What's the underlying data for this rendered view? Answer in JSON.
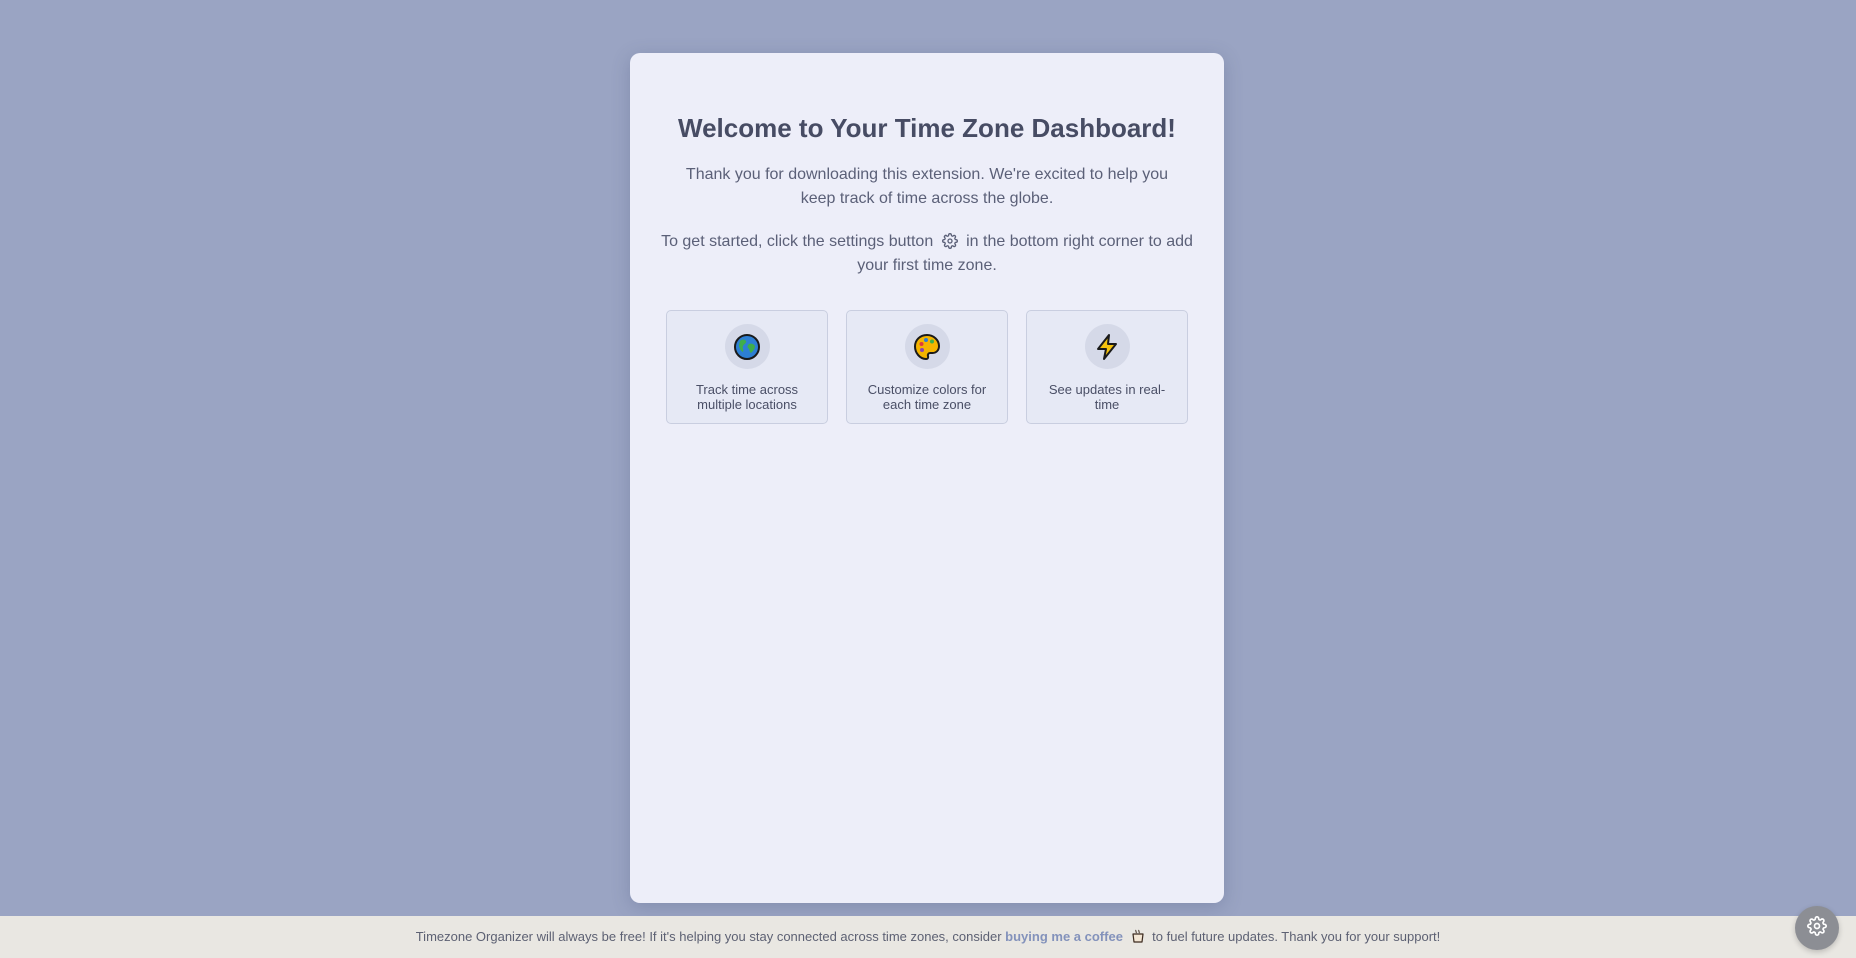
{
  "welcome": {
    "title": "Welcome to Your Time Zone Dashboard!",
    "intro": "Thank you for downloading this extension. We're excited to help you keep track of time across the globe.",
    "instructions_before": "To get started, click the settings button",
    "instructions_after": "in the bottom right corner to add your first time zone."
  },
  "features": [
    {
      "icon": "globe-icon",
      "text": "Track time across multiple locations"
    },
    {
      "icon": "palette-icon",
      "text": "Customize colors for each time zone"
    },
    {
      "icon": "lightning-icon",
      "text": "See updates in real-time"
    }
  ],
  "footer": {
    "text_before": "Timezone Organizer will always be free! If it's helping you stay connected across time zones, consider",
    "link_text": "buying me a coffee",
    "text_after": "to fuel future updates. Thank you for your support!"
  },
  "colors": {
    "background": "#9aa4c3",
    "card": "#edeef9",
    "footer": "#e9e7e2",
    "link": "#8392bb",
    "settings_button": "#8c8e94"
  }
}
